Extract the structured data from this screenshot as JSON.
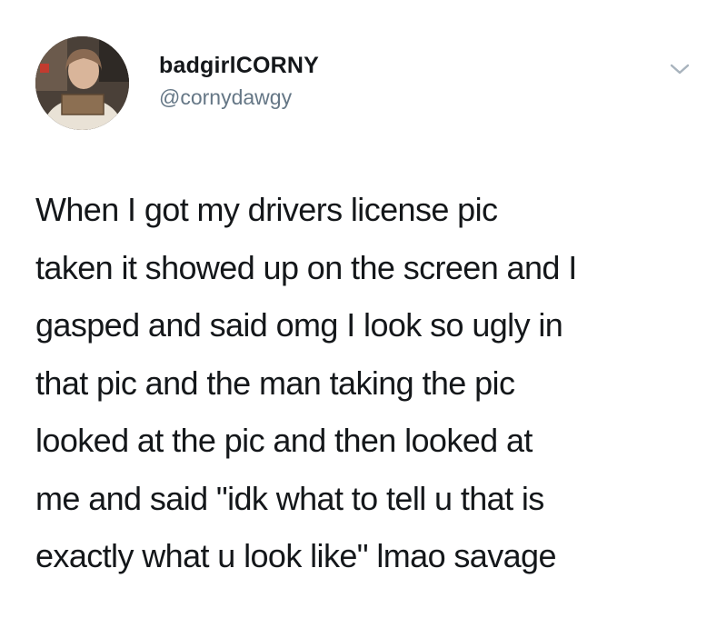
{
  "author": {
    "display_name": "badgirlCORNY",
    "handle": "@cornydawgy",
    "avatar_icon": "profile-photo"
  },
  "menu": {
    "icon": "chevron-down-icon"
  },
  "tweet": {
    "lines": [
      "When I got my drivers license pic",
      "taken it showed up on the screen and I",
      "gasped and said omg I look so ugly in",
      "that pic and the man taking the pic",
      "looked at the pic and then looked at",
      "me and said \"idk what to tell u that is",
      "exactly what u look like\" lmao savage"
    ]
  },
  "colors": {
    "text": "#14171a",
    "secondary": "#657786",
    "background": "#ffffff"
  }
}
